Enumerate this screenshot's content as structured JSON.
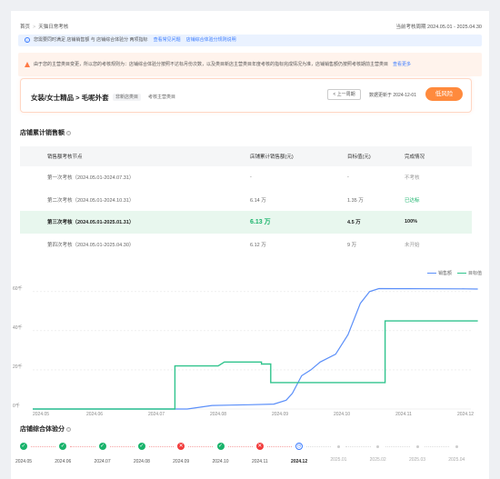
{
  "breadcrumb": {
    "home": "首页",
    "current": "天猫日常考核"
  },
  "period": {
    "label": "当前考核周期",
    "value": "2024.05.01 - 2025.04.30"
  },
  "info_banner": {
    "text": "您需要同时满足 店铺销售额 与 店铺综合体验分 两项指标",
    "link1": "查看常见问题",
    "link2": "店铺综合体验分规则说明"
  },
  "warning_banner": {
    "text": "由于您的主营类目变更，所以您的考核规则为：店铺综合体验分按照不达标月份次数，以及类目新店主营类目年度考核的指标完成情况为准，店铺销售额仍按照考核期前主营类目",
    "link": "查看更多"
  },
  "category": {
    "name": "女装/女士精品 > 毛呢外套",
    "tag": "非新店类目",
    "main_label": "考核主营类目",
    "prev_button": "< 上一周期",
    "updated_label": "数据更新于",
    "updated_date": "2024-12-01",
    "risk_button": "低风险"
  },
  "sales_section": {
    "title": "店铺累计销售额",
    "columns": [
      "销售额考核节点",
      "店铺累计销售额(元)",
      "目标值(元)",
      "完成情况"
    ],
    "rows": [
      {
        "node": "第一次考核（2024.05.01-2024.07.31）",
        "sales": "-",
        "target": "-",
        "status": "不考核",
        "status_color": "grey",
        "highlight": false
      },
      {
        "node": "第二次考核（2024.05.01-2024.10.31）",
        "sales": "6.14 万",
        "target": "1.35 万",
        "status": "已达标",
        "status_color": "green",
        "highlight": false
      },
      {
        "node": "第三次考核（2024.05.01-2025.01.31）",
        "sales": "6.13 万",
        "target": "4.5 万",
        "status": "100%",
        "status_color": "dark",
        "highlight": true
      },
      {
        "node": "第四次考核（2024.05.01-2025.04.30）",
        "sales": "6.12 万",
        "target": "9 万",
        "status": "未开始",
        "status_color": "grey",
        "highlight": false
      }
    ]
  },
  "chart_data": {
    "type": "line",
    "legend": [
      "销售额",
      "目标值"
    ],
    "y_ticks": [
      "0千",
      "20千",
      "40千",
      "60千"
    ],
    "ylim": [
      0,
      65
    ],
    "x_ticks": [
      "2024.05",
      "2024.06",
      "2024.07",
      "2024.08",
      "2024.09",
      "2024.10",
      "2024.11",
      "2024.12"
    ],
    "colors": {
      "sales": "#5b8ff9",
      "target": "#30c48d"
    },
    "series": [
      {
        "name": "销售额",
        "points": [
          [
            0,
            0
          ],
          [
            2.5,
            0
          ],
          [
            2.9,
            1.8
          ],
          [
            3.5,
            2.2
          ],
          [
            3.9,
            2.5
          ],
          [
            4.1,
            4.5
          ],
          [
            4.2,
            8
          ],
          [
            4.35,
            17
          ],
          [
            4.5,
            20
          ],
          [
            4.65,
            24
          ],
          [
            4.9,
            28
          ],
          [
            5.1,
            38
          ],
          [
            5.3,
            54
          ],
          [
            5.45,
            60
          ],
          [
            5.6,
            61.5
          ],
          [
            7.0,
            61.4
          ],
          [
            7.2,
            61.3
          ]
        ]
      },
      {
        "name": "目标值",
        "points": [
          [
            0,
            0
          ],
          [
            2.3,
            0
          ],
          [
            2.3,
            22
          ],
          [
            3.0,
            22
          ],
          [
            3.1,
            24
          ],
          [
            3.7,
            24
          ],
          [
            3.7,
            23
          ],
          [
            3.85,
            23
          ],
          [
            3.85,
            13.5
          ],
          [
            4.55,
            13.5
          ],
          [
            4.9,
            13.5
          ],
          [
            5.1,
            13.5
          ],
          [
            5.1,
            13.5
          ],
          [
            5.7,
            13.5
          ],
          [
            5.7,
            45
          ],
          [
            7.2,
            45
          ]
        ]
      }
    ]
  },
  "experience_section": {
    "title": "店铺综合体验分",
    "months": [
      {
        "label": "2024.05",
        "state": "ok"
      },
      {
        "label": "2024.06",
        "state": "ok"
      },
      {
        "label": "2024.07",
        "state": "ok"
      },
      {
        "label": "2024.08",
        "state": "ok"
      },
      {
        "label": "2024.09",
        "state": "fail"
      },
      {
        "label": "2024.10",
        "state": "ok"
      },
      {
        "label": "2024.11",
        "state": "fail"
      },
      {
        "label": "2024.12",
        "state": "current"
      },
      {
        "label": "2025.01",
        "state": "future"
      },
      {
        "label": "2025.02",
        "state": "future"
      },
      {
        "label": "2025.03",
        "state": "future"
      },
      {
        "label": "2025.04",
        "state": "future"
      }
    ]
  }
}
